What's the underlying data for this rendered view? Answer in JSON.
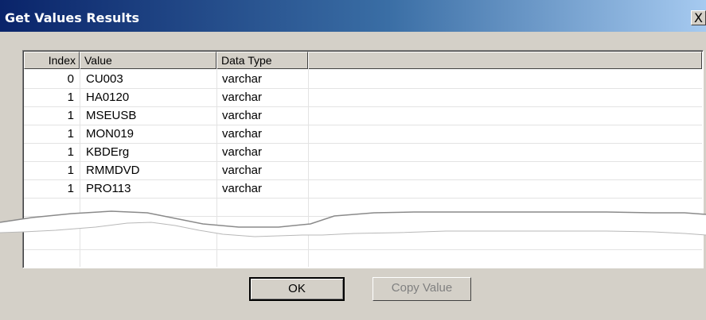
{
  "window": {
    "title": "Get Values Results",
    "close_glyph": "X"
  },
  "table": {
    "columns": [
      "Index",
      "Value",
      "Data Type",
      ""
    ],
    "rows": [
      {
        "index": "0",
        "value": "CU003",
        "type": "varchar"
      },
      {
        "index": "1",
        "value": "HA0120",
        "type": "varchar"
      },
      {
        "index": "1",
        "value": "MSEUSB",
        "type": "varchar"
      },
      {
        "index": "1",
        "value": "MON019",
        "type": "varchar"
      },
      {
        "index": "1",
        "value": "KBDErg",
        "type": "varchar"
      },
      {
        "index": "1",
        "value": "RMMDVD",
        "type": "varchar"
      },
      {
        "index": "1",
        "value": "PRO113",
        "type": "varchar"
      }
    ]
  },
  "buttons": {
    "ok": "OK",
    "copy_value": "Copy Value"
  }
}
